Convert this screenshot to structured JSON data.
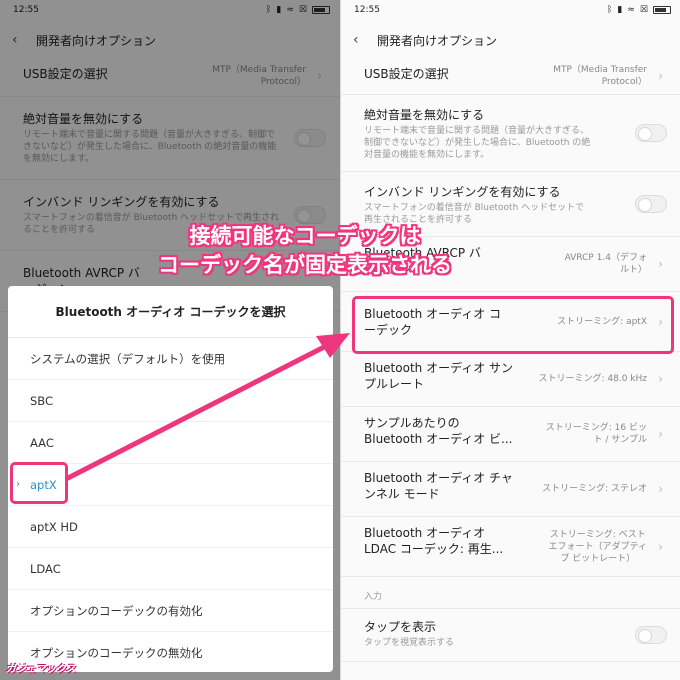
{
  "status": {
    "time": "12:55",
    "wifi": "≈",
    "signal_icon": "☒"
  },
  "header": {
    "title": "開発者向けオプション",
    "back": "‹"
  },
  "left_rows": [
    {
      "title": "USB設定の選択",
      "value": "MTP（Media Transfer Protocol）"
    },
    {
      "title": "絶対音量を無効にする",
      "sub": "リモート端末で音量に関する問題（音量が大きすぎる、制御できないなど）が発生した場合に、Bluetooth の絶対音量の機能を無効にします。"
    },
    {
      "title": "インバンド リンギングを有効にする",
      "sub": "スマートフォンの着信音が Bluetooth ヘッドセットで再生されることを許可する"
    },
    {
      "title": "Bluetooth AVRCP バージョン"
    }
  ],
  "dialog": {
    "title": "Bluetooth オーディオ コーデックを選択",
    "options": [
      "システムの選択（デフォルト）を使用",
      "SBC",
      "AAC",
      "aptX",
      "aptX HD",
      "LDAC",
      "オプションのコーデックの有効化",
      "オプションのコーデックの無効化"
    ],
    "selected": "aptX",
    "check": "›"
  },
  "right_rows": [
    {
      "title": "USB設定の選択",
      "value_1": "MTP（Media Transfer",
      "value_2": "Protocol）"
    },
    {
      "title": "絶対音量を無効にする",
      "sub_1": "リモート端末で音量に関する問題（音量が大きすぎる、",
      "sub_2": "制御できないなど）が発生した場合に、Bluetooth の絶",
      "sub_3": "対音量の機能を無効にします。"
    },
    {
      "title": "インバンド リンギングを有効にする",
      "sub_1": "スマートフォンの着信音が Bluetooth ヘッドセットで",
      "sub_2": "再生されることを許可する"
    },
    {
      "title_1": "Bluetooth AVRCP バ",
      "title_2": "ージョン",
      "value_1": "AVRCP 1.4（デフォ",
      "value_2": "ルト）"
    },
    {
      "title_1": "Bluetooth オーディオ コ",
      "title_2": "ーデック",
      "value_1": "ストリーミング: aptX"
    },
    {
      "title_1": "Bluetooth オーディオ サン",
      "title_2": "プルレート",
      "value_1": "ストリーミング: 48.0 kHz"
    },
    {
      "title_1": "サンプルあたりの",
      "title_2": "Bluetooth オーディオ ビ...",
      "value_1": "ストリーミング: 16 ビッ",
      "value_2": "ト / サンプル"
    },
    {
      "title_1": "Bluetooth オーディオ チャ",
      "title_2": "ンネル モード",
      "value_1": "ストリーミング: ステレオ"
    },
    {
      "title_1": "Bluetooth オーディオ",
      "title_2": "LDAC コーデック: 再生...",
      "value_1": "ストリーミング: ベスト",
      "value_2": "エフォート（アダプティ",
      "value_3": "ブ ビットレート）"
    }
  ],
  "right_section": "入力",
  "right_last": {
    "title": "タップを表示",
    "sub": "タップを視覚表示する"
  },
  "annotation": {
    "line1": "接続可能なコーデックは",
    "line2": "コーデック名が固定表示される",
    "color": "#f0357f"
  },
  "watermark": "ガジェマックス"
}
